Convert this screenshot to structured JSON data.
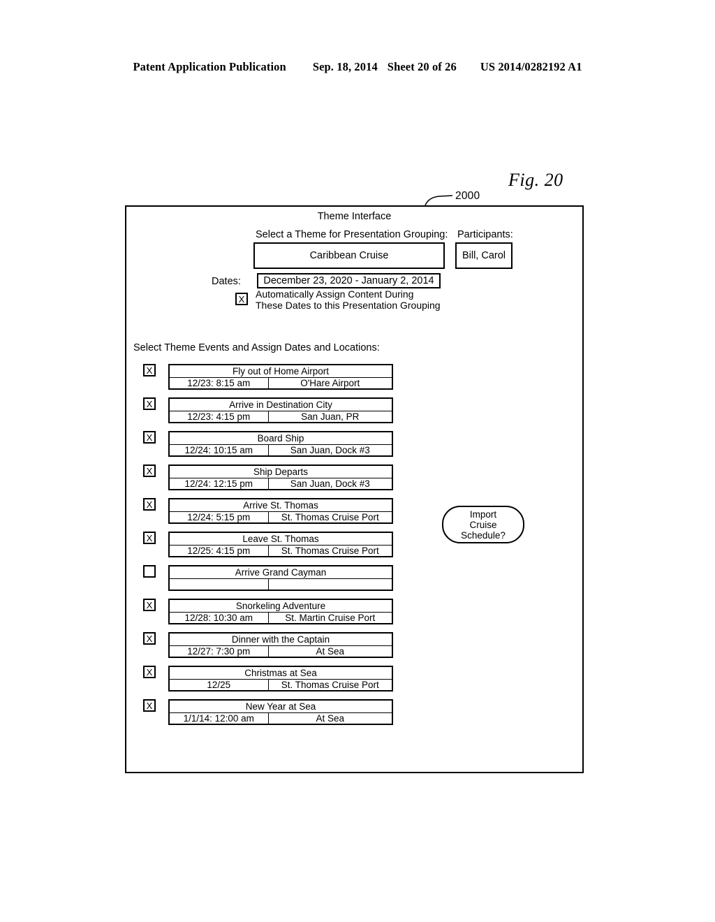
{
  "publication_header": {
    "left": "Patent Application Publication",
    "date": "Sep. 18, 2014",
    "sheet": "Sheet 20 of 26",
    "number": "US 2014/0282192 A1"
  },
  "figure": {
    "label": "Fig. 20",
    "frame_ref": "2000"
  },
  "interface": {
    "title": "Theme Interface",
    "theme_label": "Select a Theme for Presentation Grouping:",
    "theme_value": "Caribbean Cruise",
    "theme_ref": "2010",
    "participants_label": "Participants:",
    "participants_value": "Bill, Carol",
    "participants_ref": "2020",
    "dates_label": "Dates:",
    "dates_value": "December 23, 2020 - January 2, 2014",
    "dates_ref": "2030",
    "auto_assign_checkbox": "X",
    "auto_assign_ref": "2040",
    "auto_assign_line1": "Automatically Assign Content During",
    "auto_assign_line2": "These Dates to this Presentation Grouping",
    "events_label": "Select Theme Events and Assign Dates and Locations:",
    "events_ref": "2050",
    "list_ref": "2070",
    "import_button": {
      "line1": "Import",
      "line2": "Cruise",
      "line3": "Schedule?",
      "ref": "2080"
    }
  },
  "events": [
    {
      "checked": "X",
      "title": "Fly out of Home Airport",
      "date": "12/23: 8:15 am",
      "location": "O'Hare Airport",
      "ref": ""
    },
    {
      "checked": "X",
      "title": "Arrive in Destination City",
      "date": "12/23: 4:15 pm",
      "location": "San Juan, PR",
      "ref": ""
    },
    {
      "checked": "X",
      "title": "Board Ship",
      "date": "12/24: 10:15 am",
      "location": "San Juan, Dock #3",
      "ref": "2052"
    },
    {
      "checked": "X",
      "title": "Ship Departs",
      "date": "12/24: 12:15 pm",
      "location": "San Juan, Dock #3",
      "ref": ""
    },
    {
      "checked": "X",
      "title": "Arrive St. Thomas",
      "date": "12/24: 5:15 pm",
      "location": "St. Thomas Cruise Port",
      "ref": "2054"
    },
    {
      "checked": "X",
      "title": "Leave St. Thomas",
      "date": "12/25: 4:15 pm",
      "location": "St. Thomas Cruise Port",
      "ref": ""
    },
    {
      "checked": "",
      "title": "Arrive Grand Cayman",
      "date": "",
      "location": "",
      "ref": "2060"
    },
    {
      "checked": "X",
      "title": "Snorkeling Adventure",
      "date": "12/28: 10:30 am",
      "location": "St. Martin Cruise Port",
      "ref": ""
    },
    {
      "checked": "X",
      "title": "Dinner with the Captain",
      "date": "12/27: 7:30 pm",
      "location": "At Sea",
      "ref": ""
    },
    {
      "checked": "X",
      "title": "Christmas at Sea",
      "date": "12/25",
      "location": "St. Thomas Cruise Port",
      "ref": "2056"
    },
    {
      "checked": "X",
      "title": "New Year at Sea",
      "date": "1/1/14: 12:00 am",
      "location": "At Sea",
      "ref": "2058"
    }
  ],
  "colors": {
    "ink": "#000000",
    "paper": "#ffffff"
  }
}
